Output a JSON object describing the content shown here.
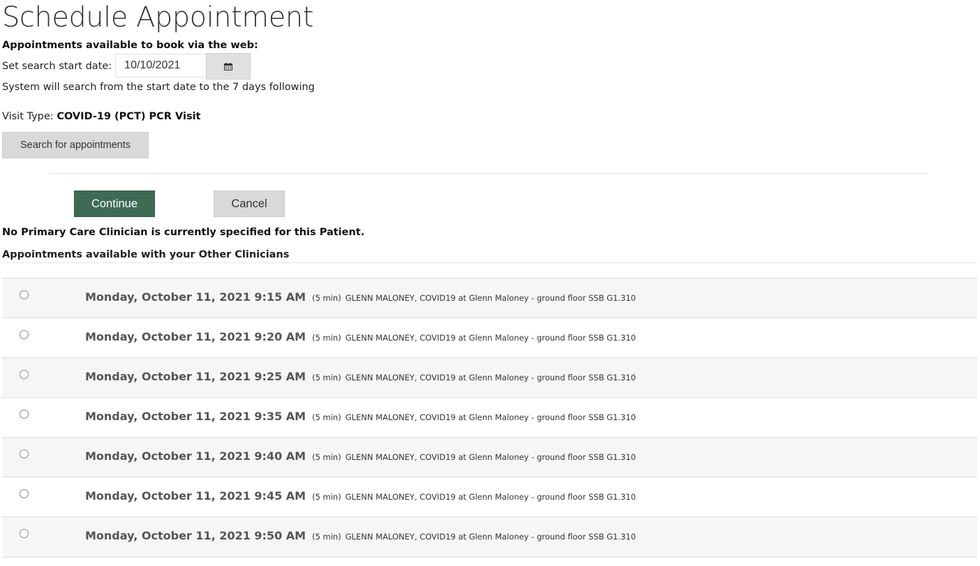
{
  "page": {
    "title": "Schedule Appointment",
    "subheading": "Appointments available to book via the web:"
  },
  "search": {
    "start_date_label": "Set search start date:",
    "start_date_value": "10/10/2021",
    "calendar_icon": "calendar-icon",
    "hint": "System will search from the start date to the 7 days following",
    "visit_type_label": "Visit Type:",
    "visit_type_value": "COVID-19 (PCT) PCR Visit",
    "search_button_label": "Search for appointments"
  },
  "actions": {
    "continue_label": "Continue",
    "cancel_label": "Cancel",
    "continue_color": "#3f6b55"
  },
  "clinician_note": "No Primary Care Clinician is currently specified for this Patient.",
  "other_section_title": "Appointments available with your Other Clinicians",
  "slots": [
    {
      "datetime": "Monday, October 11, 2021 9:15 AM",
      "duration": "(5 min)",
      "details": "GLENN MALONEY, COVID19 at Glenn Maloney - ground floor SSB G1.310",
      "selected": false
    },
    {
      "datetime": "Monday, October 11, 2021 9:20 AM",
      "duration": "(5 min)",
      "details": "GLENN MALONEY, COVID19 at Glenn Maloney - ground floor SSB G1.310",
      "selected": false
    },
    {
      "datetime": "Monday, October 11, 2021 9:25 AM",
      "duration": "(5 min)",
      "details": "GLENN MALONEY, COVID19 at Glenn Maloney - ground floor SSB G1.310",
      "selected": false
    },
    {
      "datetime": "Monday, October 11, 2021 9:35 AM",
      "duration": "(5 min)",
      "details": "GLENN MALONEY, COVID19 at Glenn Maloney - ground floor SSB G1.310",
      "selected": false
    },
    {
      "datetime": "Monday, October 11, 2021 9:40 AM",
      "duration": "(5 min)",
      "details": "GLENN MALONEY, COVID19 at Glenn Maloney - ground floor SSB G1.310",
      "selected": false
    },
    {
      "datetime": "Monday, October 11, 2021 9:45 AM",
      "duration": "(5 min)",
      "details": "GLENN MALONEY, COVID19 at Glenn Maloney - ground floor SSB G1.310",
      "selected": false
    },
    {
      "datetime": "Monday, October 11, 2021 9:50 AM",
      "duration": "(5 min)",
      "details": "GLENN MALONEY, COVID19 at Glenn Maloney - ground floor SSB G1.310",
      "selected": false
    }
  ]
}
